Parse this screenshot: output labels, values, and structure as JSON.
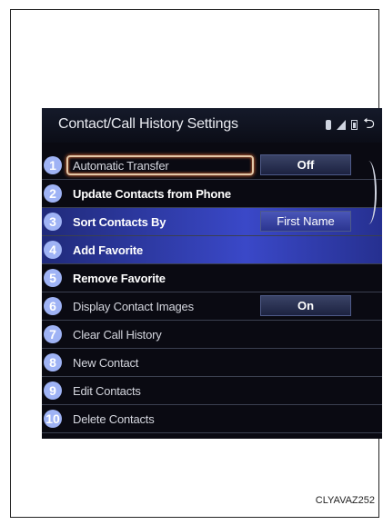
{
  "header": {
    "title": "Contact/Call History Settings"
  },
  "status_icons": [
    "bluetooth-icon",
    "signal-icon",
    "battery-icon",
    "back-icon"
  ],
  "items": [
    {
      "num": "1",
      "label": "Automatic Transfer",
      "value": "Off"
    },
    {
      "num": "2",
      "label": "Update Contacts from Phone"
    },
    {
      "num": "3",
      "label": "Sort Contacts By",
      "value": "First Name"
    },
    {
      "num": "4",
      "label": "Add Favorite"
    },
    {
      "num": "5",
      "label": "Remove Favorite"
    },
    {
      "num": "6",
      "label": "Display Contact Images",
      "value": "On"
    },
    {
      "num": "7",
      "label": "Clear Call History"
    },
    {
      "num": "8",
      "label": "New Contact"
    },
    {
      "num": "9",
      "label": "Edit Contacts"
    },
    {
      "num": "10",
      "label": "Delete Contacts"
    }
  ],
  "footer": {
    "code": "CLYAVAZ252"
  }
}
